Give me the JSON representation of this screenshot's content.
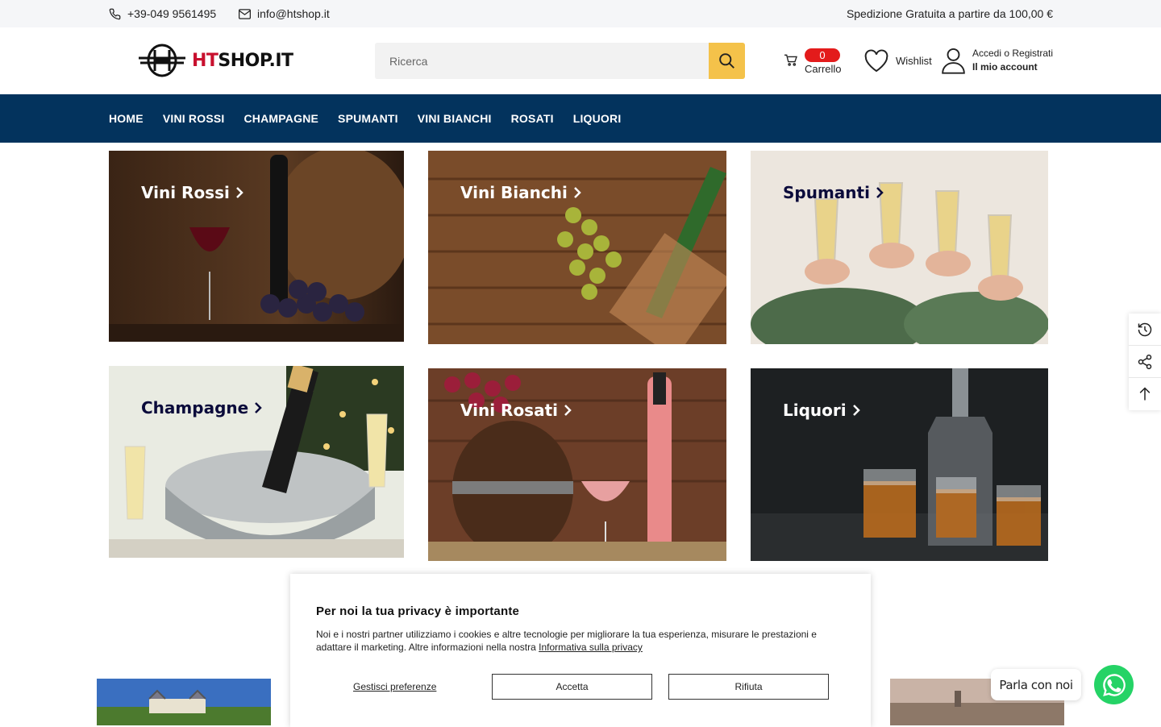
{
  "topbar": {
    "phone": "+39-049 9561495",
    "email": "info@htshop.it",
    "shipping": "Spedizione Gratuita a partire da 100,00 €"
  },
  "header": {
    "logo_prefix": "HT",
    "logo_suffix": "SHOP.IT",
    "search_placeholder": "Ricerca",
    "cart_count": "0",
    "cart_label": "Carrello",
    "wishlist_label": "Wishlist",
    "account_line1": "Accedi o Registrati",
    "account_line2": "Il mio account"
  },
  "nav": [
    "HOME",
    "VINI ROSSI",
    "CHAMPAGNE",
    "SPUMANTI",
    "VINI BIANCHI",
    "ROSATI",
    "LIQUORI"
  ],
  "categories": [
    {
      "title": "Vini Rossi",
      "color": "#ffffff"
    },
    {
      "title": "Vini Bianchi",
      "color": "#ffffff"
    },
    {
      "title": "Spumanti",
      "color": "#0b0b3b"
    },
    {
      "title": "Champagne",
      "color": "#0b0b3b"
    },
    {
      "title": "Vini Rosati",
      "color": "#ffffff"
    },
    {
      "title": "Liquori",
      "color": "#ffffff"
    }
  ],
  "cookie": {
    "title": "Per noi la tua privacy è importante",
    "text": "Noi e i nostri partner utilizziamo i cookies e altre tecnologie per migliorare la tua esperienza, misurare le prestazioni e adattare il marketing. Altre informazioni nella nostra",
    "link": "Informativa sulla privacy",
    "manage": "Gestisci preferenze",
    "accept": "Accetta",
    "reject": "Rifiuta"
  },
  "chat": {
    "label": "Parla con noi"
  },
  "colors": {
    "nav_bg": "#03335d",
    "search_button": "#f4c24a",
    "badge": "#e31b1b",
    "whatsapp": "#25d366"
  }
}
